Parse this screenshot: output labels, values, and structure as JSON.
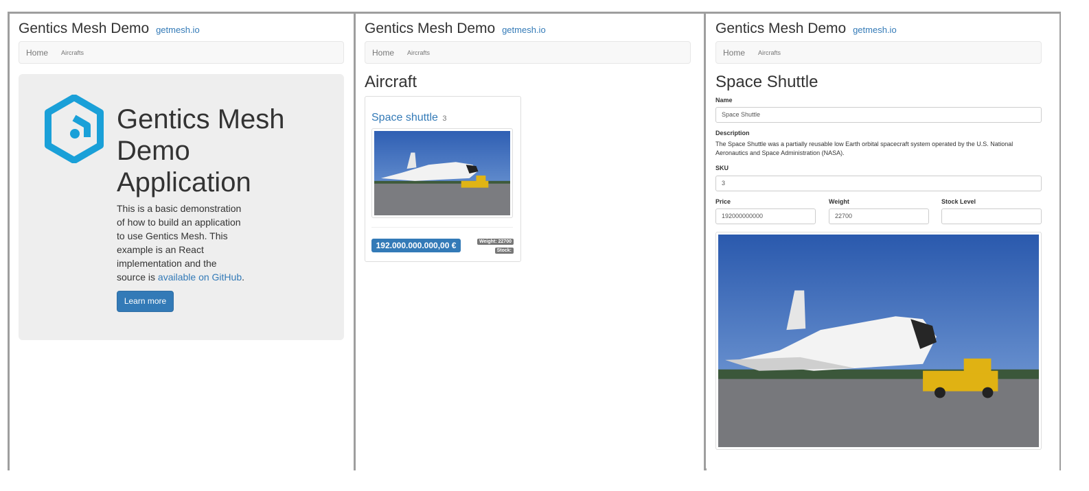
{
  "site": {
    "title": "Gentics Mesh Demo",
    "link": "getmesh.io"
  },
  "nav": {
    "home": "Home",
    "aircrafts": "Aircrafts"
  },
  "home": {
    "heading": "Gentics Mesh Demo Application",
    "lead_text": "This is a basic demonstration of how to build an application to use Gentics Mesh. This example is an React implementation and the source is ",
    "lead_link": "available on GitHub",
    "lead_end": ".",
    "learn_more": "Learn more"
  },
  "category": {
    "heading": "Aircraft",
    "product": {
      "name": "Space shuttle",
      "sku": "3",
      "price": "192.000.000.000,00 €",
      "weight": "Weight: 22700",
      "stock": "Stock:"
    }
  },
  "detail": {
    "heading": "Space Shuttle",
    "name_label": "Name",
    "name_value": "Space Shuttle",
    "description_label": "Description",
    "description": "The Space Shuttle was a partially reusable low Earth orbital spacecraft system operated by the U.S. National Aeronautics and Space Administration (NASA).",
    "sku_label": "SKU",
    "sku_value": "3",
    "price_label": "Price",
    "price_value": "192000000000",
    "weight_label": "Weight",
    "weight_value": "22700",
    "stock_label": "Stock Level",
    "stock_value": ""
  },
  "colors": {
    "primary": "#337ab7",
    "logo": "#1aa0d8",
    "jumbotron": "#eeeeee",
    "frame": "#9e9e9e"
  },
  "icons": [
    "gentics-mesh-logo-icon",
    "space-shuttle-photo"
  ]
}
